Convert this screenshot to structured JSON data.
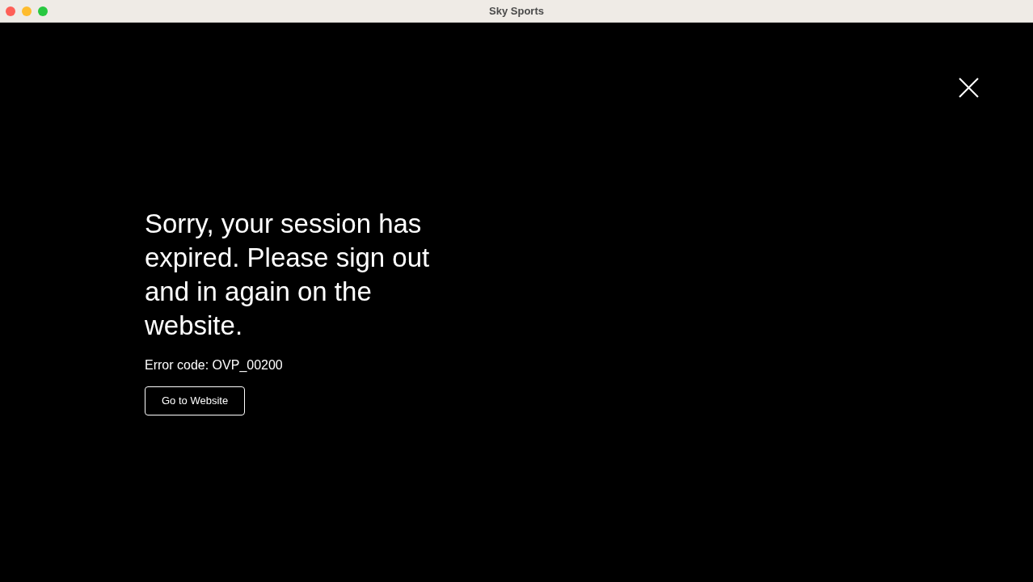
{
  "window": {
    "title": "Sky Sports"
  },
  "message": {
    "heading": "Sorry, your session has expired. Please sign out and in again on the website.",
    "error_code": "Error code: OVP_00200",
    "button": "Go to Website"
  }
}
